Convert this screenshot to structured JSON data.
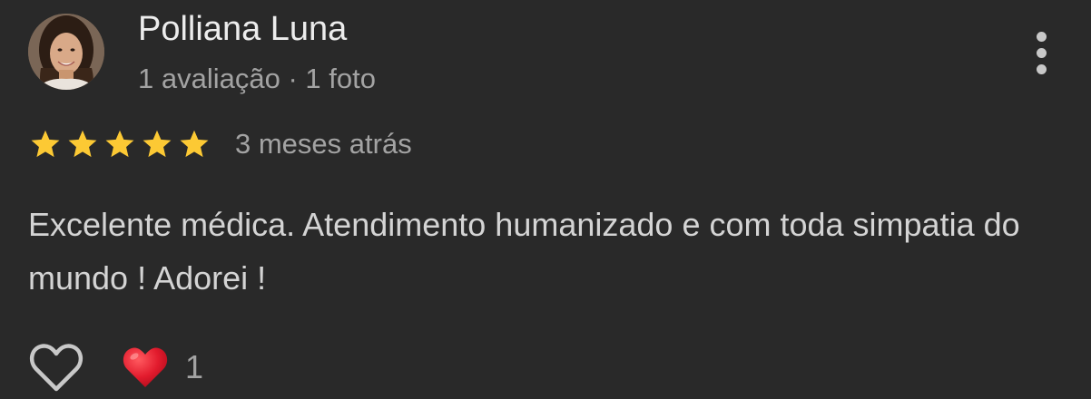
{
  "review": {
    "author_name": "Polliana Luna",
    "author_meta": "1 avaliação · 1 foto",
    "rating": 5,
    "rating_max": 5,
    "date": "3 meses atrás",
    "text": "Excelente médica. Atendimento humanizado e com toda simpatia do mundo ! Adorei !",
    "reaction_count": "1"
  },
  "colors": {
    "background": "#292929",
    "star": "#fcc934",
    "heart": "#e21b2d",
    "primary_text": "#ececec",
    "secondary_text": "#a3a3a3"
  },
  "icons": {
    "menu": "more-vertical-icon",
    "like": "heart-outline-icon",
    "reaction": "red-heart-icon"
  }
}
